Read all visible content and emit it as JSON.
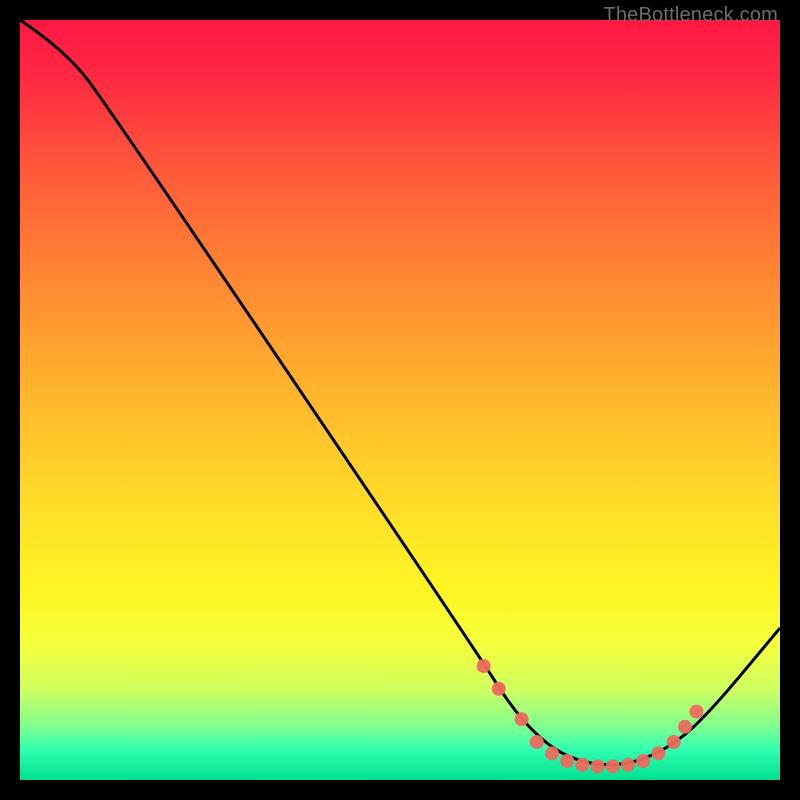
{
  "watermark": "TheBottleneck.com",
  "colors": {
    "background": "#000000",
    "curve": "#000000",
    "dots": "#ed6a5e"
  },
  "chart_data": {
    "type": "line",
    "title": "",
    "xlabel": "",
    "ylabel": "",
    "xlim": [
      0,
      100
    ],
    "ylim": [
      0,
      100
    ],
    "grid": false,
    "legend": false,
    "curve_points": [
      {
        "x": 0,
        "y": 100
      },
      {
        "x": 6,
        "y": 96
      },
      {
        "x": 12,
        "y": 88
      },
      {
        "x": 60,
        "y": 17
      },
      {
        "x": 65,
        "y": 9
      },
      {
        "x": 70,
        "y": 4
      },
      {
        "x": 75,
        "y": 2
      },
      {
        "x": 80,
        "y": 2
      },
      {
        "x": 85,
        "y": 4
      },
      {
        "x": 90,
        "y": 8
      },
      {
        "x": 100,
        "y": 20
      }
    ],
    "marker_points": [
      {
        "x": 61,
        "y": 15
      },
      {
        "x": 63,
        "y": 12
      },
      {
        "x": 66,
        "y": 8
      },
      {
        "x": 68,
        "y": 5
      },
      {
        "x": 70,
        "y": 3.5
      },
      {
        "x": 72,
        "y": 2.5
      },
      {
        "x": 74,
        "y": 2
      },
      {
        "x": 76,
        "y": 1.8
      },
      {
        "x": 78,
        "y": 1.8
      },
      {
        "x": 80,
        "y": 2
      },
      {
        "x": 82,
        "y": 2.5
      },
      {
        "x": 84,
        "y": 3.5
      },
      {
        "x": 86,
        "y": 5
      },
      {
        "x": 87.5,
        "y": 7
      },
      {
        "x": 89,
        "y": 9
      }
    ]
  }
}
